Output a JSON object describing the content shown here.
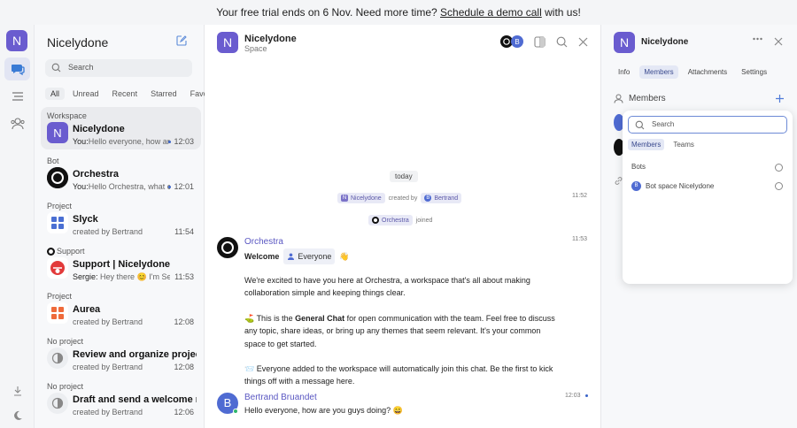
{
  "banner": {
    "before": "Your free trial ends on 6 Nov. Need more time?",
    "link": "Schedule a demo call",
    "after": "with us!"
  },
  "rail": {
    "workspace_initial": "N"
  },
  "sidebar": {
    "title": "Nicelydone",
    "search_placeholder": "Search",
    "tabs": [
      "All",
      "Unread",
      "Recent",
      "Starred",
      "Favorites"
    ],
    "groups": [
      {
        "label": "Workspace",
        "name": "Nicelydone",
        "avatar": "N",
        "sub_prefix": "You:",
        "sub": "Hello everyone, how are you",
        "time": "12:03",
        "unread": true,
        "active": true
      },
      {
        "label": "Bot",
        "name": "Orchestra",
        "avatar": "",
        "sub_prefix": "You:",
        "sub": "Hello Orchestra, what can",
        "time": "12:01",
        "unread": true,
        "active": false
      },
      {
        "label": "Project",
        "name": "Slyck",
        "avatar": "",
        "sub_prefix": "",
        "sub": "created by Bertrand",
        "time": "11:54",
        "unread": false,
        "active": false
      },
      {
        "label": "Support",
        "name": "Support | Nicelydone",
        "avatar": "",
        "sub_prefix": "Sergie:",
        "sub": "Hey there 😊 I'm Sergie",
        "time": "11:53",
        "unread": false,
        "active": false
      },
      {
        "label": "Project",
        "name": "Aurea",
        "avatar": "",
        "sub_prefix": "",
        "sub": "created by Bertrand",
        "time": "12:08",
        "unread": false,
        "active": false
      },
      {
        "label": "No project",
        "name": "Review and organize projects,",
        "avatar": "",
        "sub_prefix": "",
        "sub": "created by Bertrand",
        "time": "12:08",
        "unread": false,
        "active": false
      },
      {
        "label": "No project",
        "name": "Draft and send a welcome message",
        "avatar": "",
        "sub_prefix": "",
        "sub": "created by Bertrand",
        "time": "12:06",
        "unread": false,
        "active": false
      }
    ]
  },
  "chat": {
    "title": "Nicelydone",
    "subtitle": "Space",
    "avatar": "N",
    "today": "today",
    "sys1": {
      "chip1": "Nicelydone",
      "middle": "created by",
      "chip2": "Bertrand",
      "time": "11:52"
    },
    "sys2": {
      "chip": "Orchestra",
      "after": "joined"
    },
    "orchestra": {
      "name": "Orchestra",
      "time": "11:53",
      "welcome": "Welcome",
      "everyone": "Everyone",
      "wave": "👋",
      "p1": "We're excited to have you here at Orchestra, a workspace that's all about making collaboration simple and keeping things clear.",
      "p2_icon": "⛳",
      "p2_pre": "This is the",
      "p2_bold": "General Chat",
      "p2_post": "for open communication with the team. Feel free to discuss any topic, share ideas, or bring up any themes that seem relevant. It's your common space to get started.",
      "p3_icon": "📨",
      "p3": "Everyone added to the workspace will automatically join this chat. Be the first to kick things off with a message here."
    },
    "bertrand": {
      "name": "Bertrand Bruandet",
      "avatar": "B",
      "time": "12:03",
      "text": "Hello everyone, how are you guys doing? 😄"
    }
  },
  "rpanel": {
    "title": "Nicelydone",
    "avatar": "N",
    "tabs": [
      "Info",
      "Members",
      "Attachments",
      "Settings"
    ],
    "members_label": "Members"
  },
  "popup": {
    "search_placeholder": "Search",
    "tabs": [
      "Members",
      "Teams"
    ],
    "section": "Bots",
    "bot_name": "Bot space Nicelydone",
    "bot_initial": "B"
  },
  "colors": {
    "accent": "#6a5ccf",
    "link": "#5a57c2",
    "unread_dot": "#3a63c9"
  }
}
